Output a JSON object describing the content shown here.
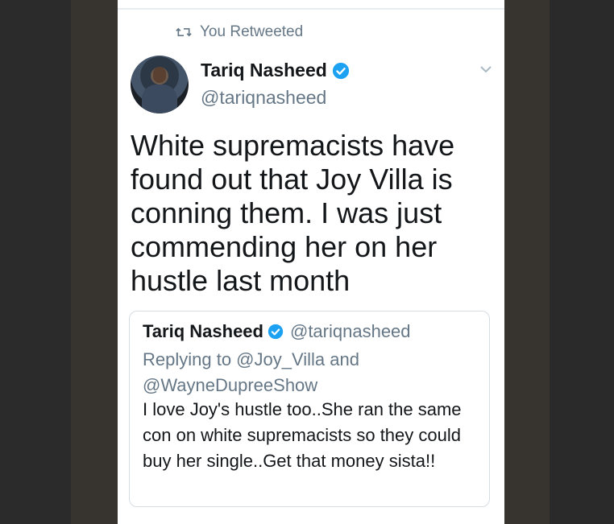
{
  "retweet_context": {
    "label": "You Retweeted",
    "icon": "retweet-icon"
  },
  "tweet": {
    "author_name": "Tariq Nasheed",
    "author_handle": "@tariqnasheed",
    "verified": true,
    "text": "White supremacists have found out that Joy Villa is conning them. I was just commending her on her hustle last month",
    "menu_icon": "chevron-down-icon"
  },
  "quoted_tweet": {
    "author_name": "Tariq Nasheed",
    "author_handle": "@tariqnasheed",
    "verified": true,
    "reply_context": "Replying to @Joy_Villa and @WayneDupreeShow",
    "text": "I love Joy's hustle too..She ran the same con on white supremacists so they could buy her single..Get that money sista!!"
  },
  "colors": {
    "verified_blue": "#1da1f2",
    "secondary_text": "#657786",
    "primary_text": "#14171a"
  }
}
